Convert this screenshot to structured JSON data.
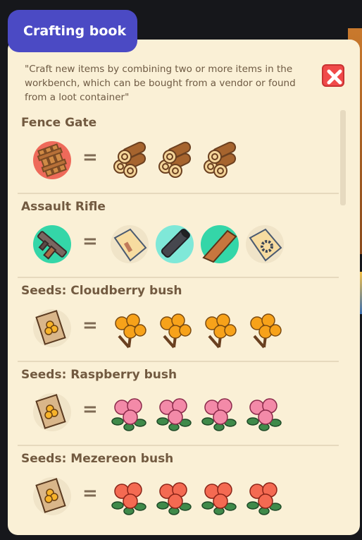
{
  "title": "Crafting book",
  "description": "\"Craft new items by combining two or more items in the workbench, which can be bought from a vendor or found from a loot container\"",
  "close_icon": "close-icon",
  "colors": {
    "title_bg": "#4b4ac4",
    "panel_bg": "#faf0d6",
    "close_bg": "#f04a4a"
  },
  "recipes": [
    {
      "name": "Fence Gate",
      "result": "fence-gate-icon",
      "ingredients": [
        "log-icon",
        "log-icon",
        "log-icon"
      ]
    },
    {
      "name": "Assault Rifle",
      "result": "assault-rifle-icon",
      "ingredients": [
        "rifle-blueprint-icon",
        "barrel-icon",
        "rifle-stock-icon",
        "gear-blueprint-icon"
      ]
    },
    {
      "name": "Seeds: Cloudberry bush",
      "result": "seed-packet-icon",
      "ingredients": [
        "cloudberry-icon",
        "cloudberry-icon",
        "cloudberry-icon",
        "cloudberry-icon"
      ]
    },
    {
      "name": "Seeds: Raspberry bush",
      "result": "seed-packet-icon",
      "ingredients": [
        "raspberry-icon",
        "raspberry-icon",
        "raspberry-icon",
        "raspberry-icon"
      ]
    },
    {
      "name": "Seeds: Mezereon bush",
      "result": "seed-packet-icon",
      "ingredients": [
        "mezereon-icon",
        "mezereon-icon",
        "mezereon-icon",
        "mezereon-icon"
      ]
    }
  ],
  "equals_sign": "="
}
